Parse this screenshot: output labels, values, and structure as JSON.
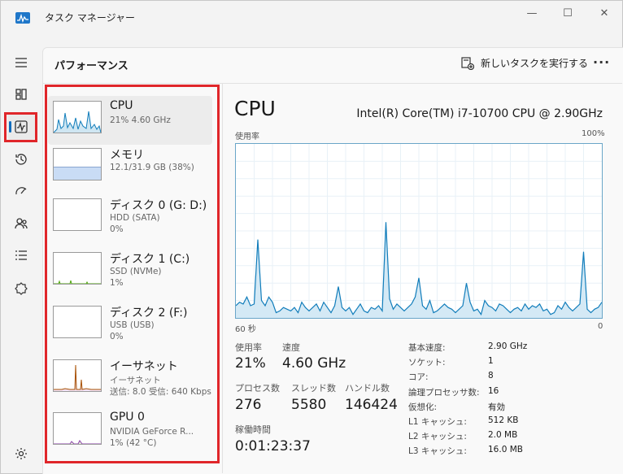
{
  "window": {
    "title": "タスク マネージャー",
    "minimize": "—",
    "maximize": "☐",
    "close": "✕"
  },
  "header": {
    "page_title": "パフォーマンス",
    "run_task_label": "新しいタスクを実行する",
    "more_label": "···"
  },
  "nav": {
    "items": [
      {
        "name": "hamburger-menu-icon"
      },
      {
        "name": "processes-icon"
      },
      {
        "name": "performance-icon",
        "active": true
      },
      {
        "name": "app-history-icon"
      },
      {
        "name": "startup-apps-icon"
      },
      {
        "name": "users-icon"
      },
      {
        "name": "details-icon"
      },
      {
        "name": "services-icon"
      },
      {
        "name": "settings-icon"
      }
    ]
  },
  "devices": [
    {
      "name": "CPU",
      "line1": "21%  4.60 GHz",
      "line2": "",
      "selected": true,
      "color": "#117dbb"
    },
    {
      "name": "メモリ",
      "line1": "12.1/31.9 GB (38%)",
      "line2": "",
      "color": "#8b12ae"
    },
    {
      "name": "ディスク 0 (G: D:)",
      "line1": "HDD (SATA)",
      "line2": "0%",
      "color": "#4da60c"
    },
    {
      "name": "ディスク 1 (C:)",
      "line1": "SSD (NVMe)",
      "line2": "1%",
      "color": "#4da60c"
    },
    {
      "name": "ディスク 2 (F:)",
      "line1": "USB (USB)",
      "line2": "0%",
      "color": "#4da60c"
    },
    {
      "name": "イーサネット",
      "line1": "イーサネット",
      "line2": "送信: 8.0 受信: 640 Kbps",
      "color": "#a74f01"
    },
    {
      "name": "GPU 0",
      "line1": "NVIDIA GeForce R...",
      "line2": "1%  (42 °C)",
      "color": "#8e44ad"
    }
  ],
  "detail": {
    "title": "CPU",
    "model": "Intel(R) Core(TM) i7-10700 CPU @ 2.90GHz",
    "graph_label": "使用率",
    "graph_max": "100%",
    "graph_time": "60 秒",
    "graph_min": "0",
    "usage_values": [
      7,
      9,
      8,
      12,
      7,
      8,
      45,
      10,
      7,
      12,
      9,
      3,
      4,
      6,
      5,
      4,
      6,
      3,
      9,
      6,
      4,
      6,
      8,
      4,
      9,
      6,
      3,
      7,
      18,
      6,
      4,
      6,
      2,
      5,
      8,
      4,
      3,
      6,
      5,
      7,
      4,
      55,
      11,
      5,
      8,
      6,
      4,
      6,
      8,
      12,
      23,
      7,
      5,
      10,
      3,
      4,
      6,
      8,
      6,
      5,
      3,
      5,
      7,
      20,
      9,
      4,
      5,
      2,
      10,
      7,
      6,
      4,
      8,
      7,
      5,
      3,
      5,
      6,
      4,
      8,
      5,
      7,
      6,
      8,
      4,
      5,
      2,
      3,
      7,
      5,
      9,
      6,
      4,
      6,
      8,
      38,
      5,
      3,
      5,
      6,
      9
    ],
    "stats": {
      "usage_label": "使用率",
      "usage_value": "21%",
      "speed_label": "速度",
      "speed_value": "4.60 GHz",
      "processes_label": "プロセス数",
      "processes_value": "276",
      "threads_label": "スレッド数",
      "threads_value": "5580",
      "handles_label": "ハンドル数",
      "handles_value": "146424",
      "uptime_label": "稼働時間",
      "uptime_value": "0:01:23:37"
    },
    "specs": [
      {
        "label": "基本速度:",
        "value": "2.90 GHz"
      },
      {
        "label": "ソケット:",
        "value": "1"
      },
      {
        "label": "コア:",
        "value": "8"
      },
      {
        "label": "論理プロセッサ数:",
        "value": "16"
      },
      {
        "label": "仮想化:",
        "value": "有効"
      },
      {
        "label": "L1 キャッシュ:",
        "value": "512 KB"
      },
      {
        "label": "L2 キャッシュ:",
        "value": "2.0 MB"
      },
      {
        "label": "L3 キャッシュ:",
        "value": "16.0 MB"
      }
    ]
  },
  "colors": {
    "cpu_line": "#117dbb",
    "cpu_fill": "#d4e9f5",
    "highlight": "#e0262a",
    "accent": "#0f6cbd"
  }
}
